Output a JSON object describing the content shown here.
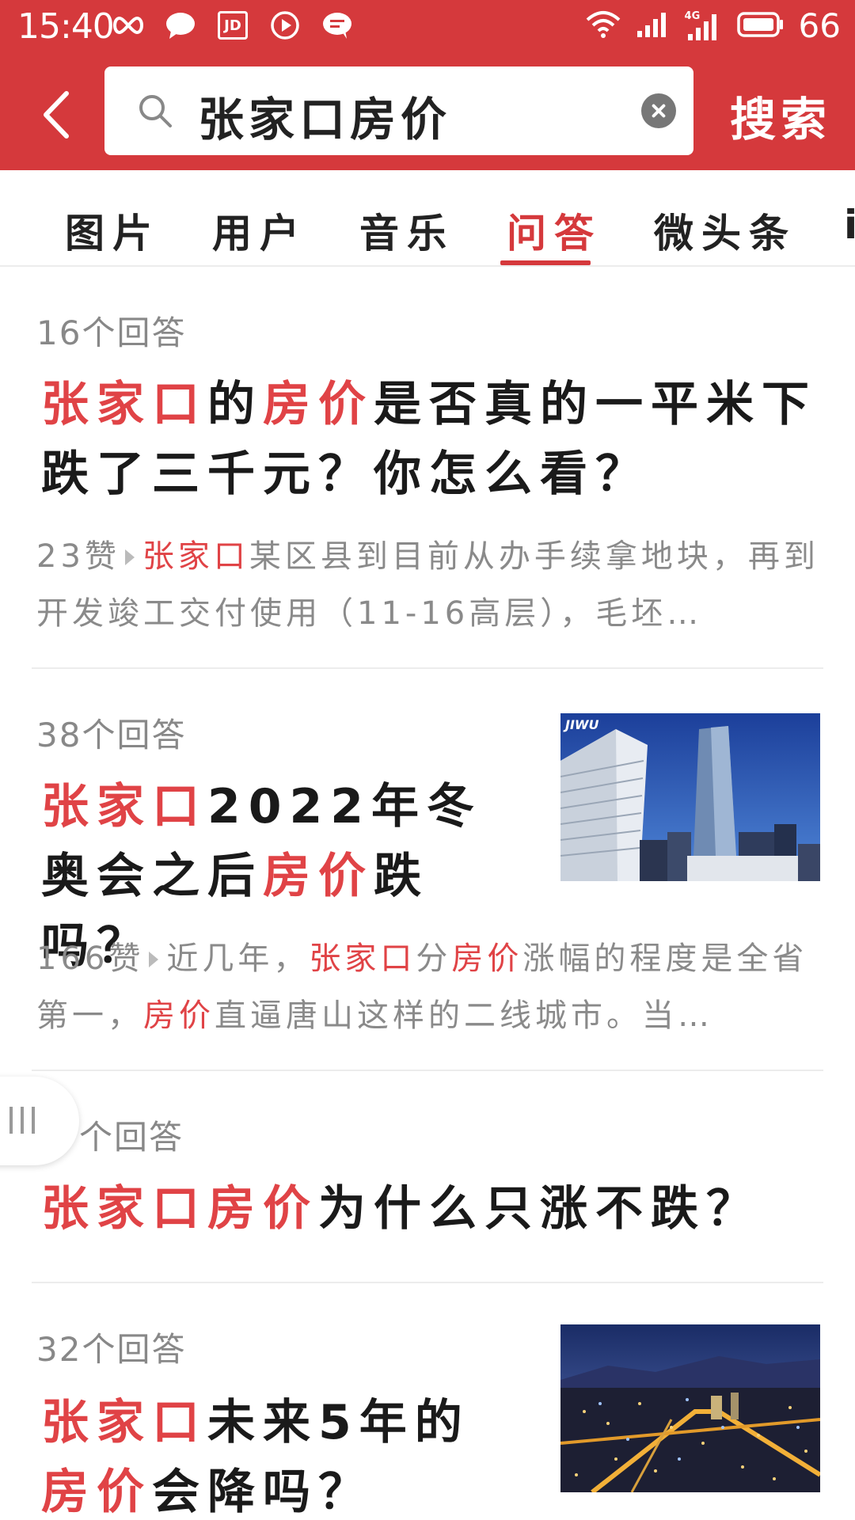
{
  "status_bar": {
    "time": "15:40",
    "left_icons": [
      "infinity-icon",
      "chat-bubble-icon",
      "jd-icon",
      "play-icon",
      "message-icon"
    ],
    "jd_label": "JD",
    "network_label": "4G",
    "battery": "66"
  },
  "header": {
    "query": "张家口房价",
    "search_button": "搜索",
    "accent_color": "#d5393c"
  },
  "tabs": [
    {
      "label": "图片"
    },
    {
      "label": "用户"
    },
    {
      "label": "音乐"
    },
    {
      "label": "问答",
      "active": true
    },
    {
      "label": "微头条"
    },
    {
      "label": "i"
    }
  ],
  "results": [
    {
      "answers": "16个回答",
      "title_parts": [
        {
          "text": "张家口",
          "hl": true
        },
        {
          "text": "的",
          "hl": false
        },
        {
          "text": "房价",
          "hl": true
        },
        {
          "text": "是否真的一平米下跌了三千元？你怎么看？",
          "hl": false
        }
      ],
      "likes": "23赞",
      "snippet_parts": [
        {
          "text": "张家口",
          "hl": true
        },
        {
          "text": "某区县到目前从办手续拿地块，再到开发竣工交付使用（11-16高层），毛坯…",
          "hl": false
        }
      ]
    },
    {
      "answers": "38个回答",
      "title_parts": [
        {
          "text": "张家口",
          "hl": true
        },
        {
          "text": "2022年冬奥会之后",
          "hl": false
        },
        {
          "text": "房价",
          "hl": true
        },
        {
          "text": "跌吗？",
          "hl": false
        }
      ],
      "image_watermark": "JIWU",
      "likes": "166赞",
      "snippet_parts": [
        {
          "text": "近几年，",
          "hl": false
        },
        {
          "text": "张家口",
          "hl": true
        },
        {
          "text": "分",
          "hl": false
        },
        {
          "text": "房价",
          "hl": true
        },
        {
          "text": "涨幅的程度是全省第一，",
          "hl": false
        },
        {
          "text": "房价",
          "hl": true
        },
        {
          "text": "直逼唐山这样的二线城市。当…",
          "hl": false
        }
      ]
    },
    {
      "answers": "个回答",
      "title_parts": [
        {
          "text": "张家口房价",
          "hl": true
        },
        {
          "text": "为什么只涨不跌？",
          "hl": false
        }
      ]
    },
    {
      "answers": "32个回答",
      "title_parts": [
        {
          "text": "张家口",
          "hl": true
        },
        {
          "text": "未来5年的",
          "hl": false
        },
        {
          "text": "房价",
          "hl": true
        },
        {
          "text": "会降吗？",
          "hl": false
        }
      ]
    }
  ]
}
